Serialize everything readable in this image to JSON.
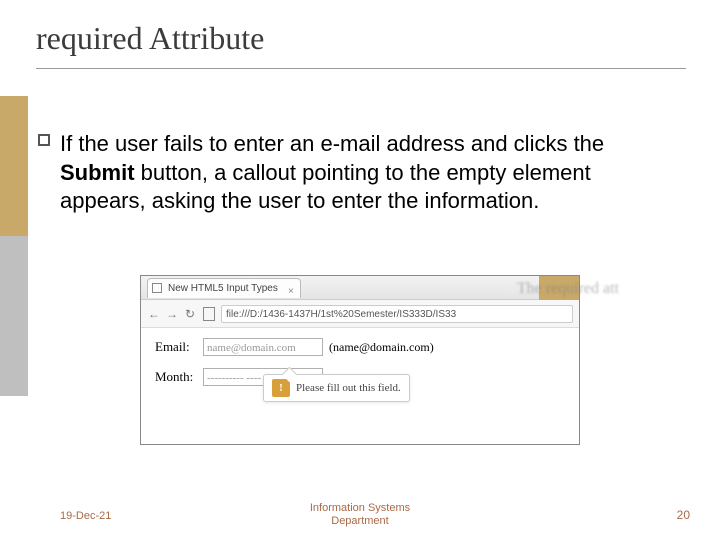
{
  "title": "required Attribute",
  "body": {
    "pre": "If the user fails to enter an e-mail address and clicks the ",
    "bold": "Submit",
    "post": " button, a callout pointing to the empty element appears, asking the user to enter the information."
  },
  "screenshot": {
    "tab_title": "New HTML5 Input Types",
    "tab_close": "×",
    "nav": {
      "back": "←",
      "fwd": "→",
      "reload": "↻"
    },
    "url": "file:///D:/1436-1437H/1st%20Semester/IS333D/IS33",
    "right_text": "The required att",
    "form": {
      "email_label": "Email:",
      "email_placeholder": "name@domain.com",
      "email_hint": "(name@domain.com)",
      "month_label": "Month:",
      "month_placeholder": "---------- ----"
    },
    "callout": {
      "icon": "!",
      "text": "Please fill out this field."
    }
  },
  "footer": {
    "date": "19-Dec-21",
    "center_line1": "Information Systems",
    "center_line2": "Department",
    "page": "20"
  }
}
